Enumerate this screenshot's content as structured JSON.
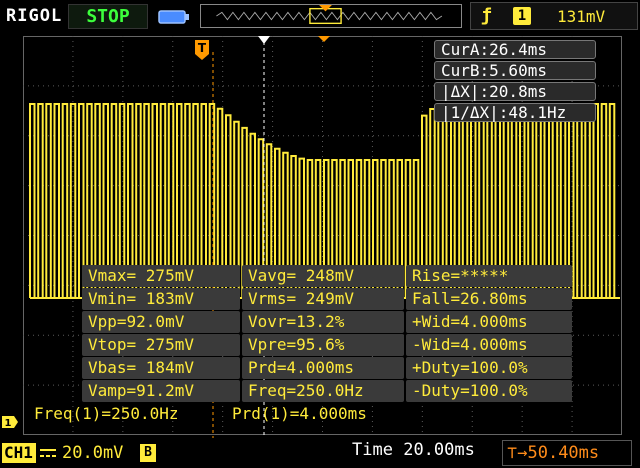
{
  "header": {
    "brand": "RIGOL",
    "run_state": "STOP",
    "trigger_channel": "1",
    "trigger_level": "131mV"
  },
  "cursors": {
    "cur_a": "CurA:26.4ms",
    "cur_b": "CurB:5.60ms",
    "delta_x": "|ΔX|:20.8ms",
    "inv_delta_x": "|1/ΔX|:48.1Hz"
  },
  "measurements": {
    "rows": [
      [
        "Vmax= 275mV",
        "Vavg= 248mV",
        "Rise=*****"
      ],
      [
        "Vmin= 183mV",
        "Vrms= 249mV",
        "Fall=26.80ms"
      ],
      [
        "Vpp=92.0mV",
        "Vovr=13.2%",
        "+Wid=4.000ms"
      ],
      [
        "Vtop= 275mV",
        "Vpre=95.6%",
        "-Wid=4.000ms"
      ],
      [
        "Vbas= 184mV",
        "Prd=4.000ms",
        "+Duty=100.0%"
      ],
      [
        "Vamp=91.2mV",
        "Freq=250.0Hz",
        "-Duty=100.0%"
      ]
    ]
  },
  "counters": {
    "freq": "Freq(1)=250.0Hz",
    "prd": "Prd(1)=4.000ms"
  },
  "footer": {
    "channel": "CH1",
    "volts_div": "20.0mV",
    "bw_limit": "B",
    "time_label": "Time",
    "time_div": "20.00ms",
    "trigger_offset": "50.40ms"
  },
  "colors": {
    "trace": "#ffeb3b",
    "grid": "#5a5a5a",
    "marker": "#ff9900",
    "stop": "#3cff3c"
  },
  "icons": [
    "battery-icon",
    "trigger-edge-icon",
    "trigger-marker-icon",
    "dc-coupling-icon",
    "ground-marker-icon"
  ]
}
